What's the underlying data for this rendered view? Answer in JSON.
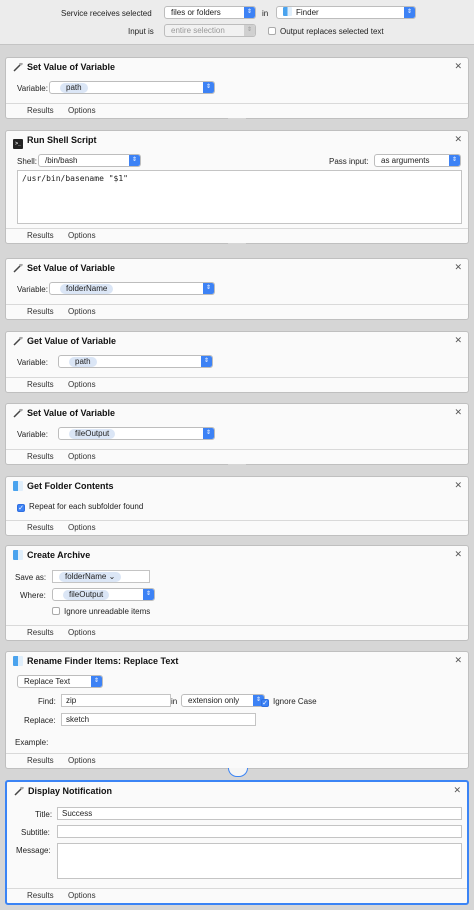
{
  "header": {
    "service_receives_label": "Service receives selected",
    "input_type": "files or folders",
    "in_label": "in",
    "app": "Finder",
    "input_is_label": "Input is",
    "input_is_value": "entire selection",
    "output_replaces_label": "Output replaces selected text"
  },
  "common": {
    "results": "Results",
    "options": "Options"
  },
  "actions": [
    {
      "title": "Set Value of Variable",
      "variable_label": "Variable:",
      "variable": "path"
    },
    {
      "title": "Run Shell Script",
      "shell_label": "Shell:",
      "shell": "/bin/bash",
      "pass_input_label": "Pass input:",
      "pass_input": "as arguments",
      "script": "/usr/bin/basename \"$1\""
    },
    {
      "title": "Set Value of Variable",
      "variable_label": "Variable:",
      "variable": "folderName"
    },
    {
      "title": "Get Value of Variable",
      "variable_label": "Variable:",
      "variable": "path"
    },
    {
      "title": "Set Value of Variable",
      "variable_label": "Variable:",
      "variable": "fileOutput"
    },
    {
      "title": "Get Folder Contents",
      "repeat_label": "Repeat for each subfolder found",
      "repeat_checked": true
    },
    {
      "title": "Create Archive",
      "save_as_label": "Save as:",
      "save_as": "folderName",
      "where_label": "Where:",
      "where": "fileOutput",
      "ignore_label": "Ignore unreadable items"
    },
    {
      "title": "Rename Finder Items: Replace Text",
      "mode": "Replace Text",
      "find_label": "Find:",
      "find": "zip",
      "in_label": "in",
      "scope": "extension only",
      "ignore_case_label": "Ignore Case",
      "replace_label": "Replace:",
      "replace": "sketch",
      "example_label": "Example:"
    },
    {
      "title": "Display Notification",
      "title_label": "Title:",
      "title_value": "Success",
      "subtitle_label": "Subtitle:",
      "message_label": "Message:"
    }
  ]
}
